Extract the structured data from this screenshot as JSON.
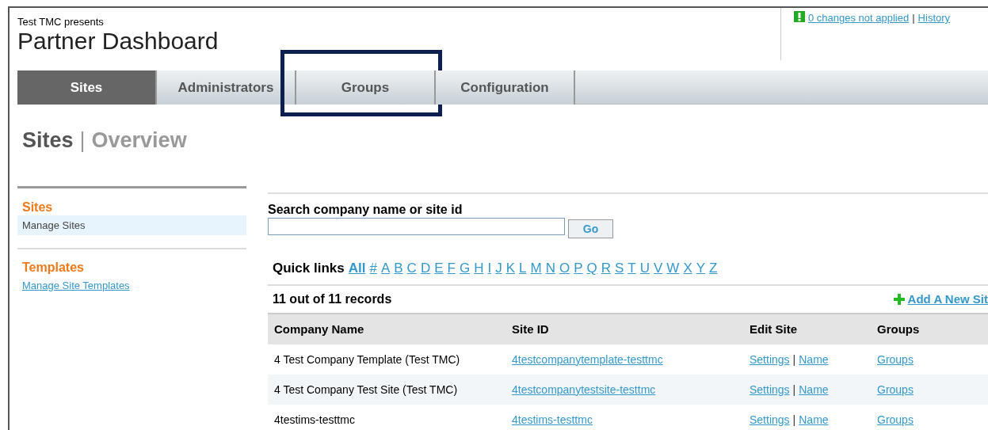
{
  "header": {
    "presenter": "Test TMC presents",
    "title": "Partner Dashboard",
    "changes_link": "0 changes not applied",
    "separator": "|",
    "history_link": "History"
  },
  "tabs": [
    {
      "label": "Sites",
      "selected": true,
      "highlighted": false
    },
    {
      "label": "Administrators",
      "selected": false,
      "highlighted": false
    },
    {
      "label": "Groups",
      "selected": false,
      "highlighted": true
    },
    {
      "label": "Configuration",
      "selected": false,
      "highlighted": false
    }
  ],
  "page_title": {
    "section": "Sites",
    "separator": "|",
    "sub": "Overview"
  },
  "sidebar": [
    {
      "heading": "Sites",
      "items": [
        {
          "label": "Manage Sites",
          "selected": true
        }
      ]
    },
    {
      "heading": "Templates",
      "items": [
        {
          "label": "Manage Site Templates",
          "selected": false
        }
      ]
    }
  ],
  "search": {
    "label": "Search company name or site id",
    "button": "Go"
  },
  "quick_links": {
    "label": "Quick links",
    "links": [
      "All",
      "#",
      "A",
      "B",
      "C",
      "D",
      "E",
      "F",
      "G",
      "H",
      "I",
      "J",
      "K",
      "L",
      "M",
      "N",
      "O",
      "P",
      "Q",
      "R",
      "S",
      "T",
      "U",
      "V",
      "W",
      "X",
      "Y",
      "Z"
    ]
  },
  "records": {
    "count": "11 out of 11 records",
    "add_link": "Add A New Sit"
  },
  "table": {
    "columns": [
      "Company Name",
      "Site ID",
      "Edit Site",
      "Groups"
    ],
    "rows": [
      {
        "company": "4 Test Company Template (Test TMC)",
        "site_id": "4testcompanytemplate-testtmc",
        "settings": "Settings",
        "separator": "|",
        "name": "Name",
        "groups": "Groups"
      },
      {
        "company": "4 Test Company Test Site (Test TMC)",
        "site_id": "4testcompanytestsite-testtmc",
        "settings": "Settings",
        "separator": "|",
        "name": "Name",
        "groups": "Groups"
      },
      {
        "company": "4testims-testtmc",
        "site_id": "4testims-testtmc",
        "settings": "Settings",
        "separator": "|",
        "name": "Name",
        "groups": "Groups"
      }
    ]
  }
}
